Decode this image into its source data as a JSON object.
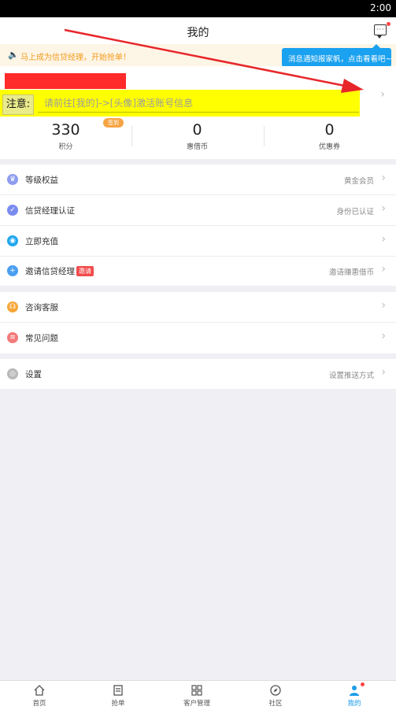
{
  "status_bar": {
    "time": "2:00"
  },
  "header": {
    "title": "我的"
  },
  "notice_bar": {
    "text": "马上成为信贷经理，开始抢单！"
  },
  "tooltip": {
    "text": "消息通知报家帆，点击看看吧~"
  },
  "profile": {
    "notice_label": "注意:",
    "notice_hint": "请前往[我的]->[头像]激活账号信息",
    "sign_badge": "签到",
    "stats": [
      {
        "value": "330",
        "label": "积分"
      },
      {
        "value": "0",
        "label": "惠借币"
      },
      {
        "value": "0",
        "label": "优惠券"
      }
    ]
  },
  "menu": {
    "group1": [
      {
        "label": "等级权益",
        "value": "黄金会员",
        "icon": "crown-icon",
        "color": "#8e9df0"
      },
      {
        "label": "信贷经理认证",
        "value": "身份已认证",
        "icon": "verify-icon",
        "color": "#7b8cf0"
      },
      {
        "label": "立即充值",
        "value": "",
        "icon": "recharge-icon",
        "color": "#20a7ef"
      },
      {
        "label": "邀请信贷经理",
        "value": "邀请赚惠借币",
        "icon": "invite-icon",
        "color": "#4a9ff0",
        "badge": "邀请"
      }
    ],
    "group2": [
      {
        "label": "咨询客服",
        "value": "",
        "icon": "headset-icon",
        "color": "#f6a73a"
      },
      {
        "label": "常见问题",
        "value": "",
        "icon": "faq-icon",
        "color": "#f47a7a"
      }
    ],
    "group3": [
      {
        "label": "设置",
        "value": "设置推送方式",
        "icon": "settings-icon",
        "color": "#b8b8b8"
      }
    ]
  },
  "tabbar": [
    {
      "label": "首页",
      "icon": "home-icon"
    },
    {
      "label": "抢单",
      "icon": "orders-icon"
    },
    {
      "label": "客户管理",
      "icon": "grid-icon"
    },
    {
      "label": "社区",
      "icon": "compass-icon"
    },
    {
      "label": "我的",
      "icon": "user-icon",
      "active": true
    }
  ]
}
